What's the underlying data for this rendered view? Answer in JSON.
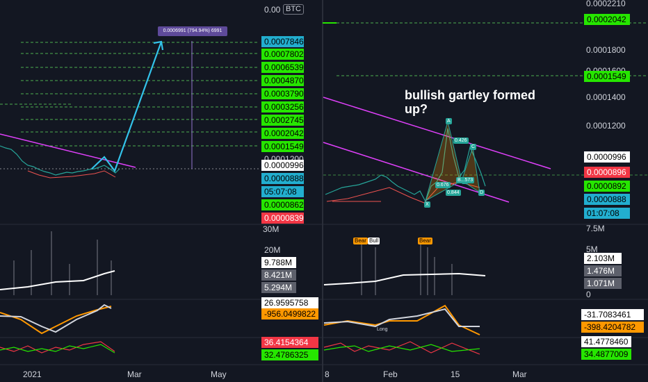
{
  "left_chart": {
    "currency": "BTC",
    "price_axis": [
      "0.00",
      "0.0001200"
    ],
    "measure_label": "0.0006991 (794.94%) 6991",
    "price_tags": [
      {
        "text": "0.0007846",
        "bg": "#22aecf",
        "fg": "#000"
      },
      {
        "text": "0.0007802",
        "bg": "#26e600",
        "fg": "#000"
      },
      {
        "text": "0.0006539",
        "bg": "#26e600",
        "fg": "#000"
      },
      {
        "text": "0.0004870",
        "bg": "#26e600",
        "fg": "#000"
      },
      {
        "text": "0.0003790",
        "bg": "#26e600",
        "fg": "#000"
      },
      {
        "text": "0.0003256",
        "bg": "#26e600",
        "fg": "#000"
      },
      {
        "text": "0.0002745",
        "bg": "#26e600",
        "fg": "#000"
      },
      {
        "text": "0.0002042",
        "bg": "#26e600",
        "fg": "#000"
      },
      {
        "text": "0.0001549",
        "bg": "#26e600",
        "fg": "#000"
      },
      {
        "text": "0.0000996",
        "bg": "#ffffff",
        "fg": "#000"
      },
      {
        "text": "0.0000888",
        "bg": "#22aecf",
        "fg": "#000"
      },
      {
        "text": "05:07:08",
        "bg": "#22aecf",
        "fg": "#000"
      },
      {
        "text": "0.0000862",
        "bg": "#26e600",
        "fg": "#000"
      },
      {
        "text": "0.0000839",
        "bg": "#f23645",
        "fg": "#fff"
      }
    ],
    "volume_axis": [
      "30M",
      "20M"
    ],
    "volume_tags": [
      {
        "text": "9.788M",
        "bg": "#ffffff",
        "fg": "#000"
      },
      {
        "text": "8.421M",
        "bg": "#5d606b",
        "fg": "#fff"
      },
      {
        "text": "5.294M",
        "bg": "#5d606b",
        "fg": "#fff"
      }
    ],
    "osc_tags": [
      {
        "text": "26.9595758",
        "bg": "#ffffff",
        "fg": "#000"
      },
      {
        "text": "-956.0499822",
        "bg": "#ff9800",
        "fg": "#000"
      }
    ],
    "rsi_tags": [
      {
        "text": "36.4154364",
        "bg": "#f23645",
        "fg": "#fff"
      },
      {
        "text": "32.4786325",
        "bg": "#26e600",
        "fg": "#000"
      }
    ],
    "x_labels": [
      "2021",
      "Mar",
      "May"
    ]
  },
  "right_chart": {
    "price_axis": [
      "0.0002210",
      "0.0001800",
      "0.0001600",
      "0.0001400",
      "0.0001200"
    ],
    "annotation_line1": "bullish gartley formed",
    "annotation_line2": "up?",
    "pattern_points": [
      "A",
      "C",
      "D",
      "X",
      "B"
    ],
    "ratio_labels": [
      "0.426",
      "0.676",
      "0.844",
      "B...573"
    ],
    "price_tags": [
      {
        "text": "0.0002042",
        "bg": "#26e600",
        "fg": "#000"
      },
      {
        "text": "0.0001549",
        "bg": "#26e600",
        "fg": "#000"
      },
      {
        "text": "0.0000996",
        "bg": "#ffffff",
        "fg": "#000"
      },
      {
        "text": "0.0000896",
        "bg": "#f23645",
        "fg": "#fff"
      },
      {
        "text": "0.0000892",
        "bg": "#26e600",
        "fg": "#000"
      },
      {
        "text": "0.0000888",
        "bg": "#22aecf",
        "fg": "#000"
      },
      {
        "text": "01:07:08",
        "bg": "#22aecf",
        "fg": "#000"
      }
    ],
    "volume_axis": [
      "7.5M",
      "5M",
      "0"
    ],
    "volume_tags": [
      {
        "text": "2.103M",
        "bg": "#ffffff",
        "fg": "#000"
      },
      {
        "text": "1.476M",
        "bg": "#5d606b",
        "fg": "#fff"
      },
      {
        "text": "1.071M",
        "bg": "#5d606b",
        "fg": "#fff"
      }
    ],
    "bear_tags": [
      "Bear",
      "Bull",
      "Bear"
    ],
    "osc_tags": [
      {
        "text": "-31.7083461",
        "bg": "#ffffff",
        "fg": "#000"
      },
      {
        "text": "-398.4204782",
        "bg": "#ff9800",
        "fg": "#000"
      }
    ],
    "long_label": "Long",
    "rsi_tags": [
      {
        "text": "41.4778460",
        "bg": "#ffffff",
        "fg": "#000"
      },
      {
        "text": "34.4877009",
        "bg": "#26e600",
        "fg": "#000"
      }
    ],
    "x_labels": [
      "8",
      "Feb",
      "15",
      "Mar"
    ]
  }
}
